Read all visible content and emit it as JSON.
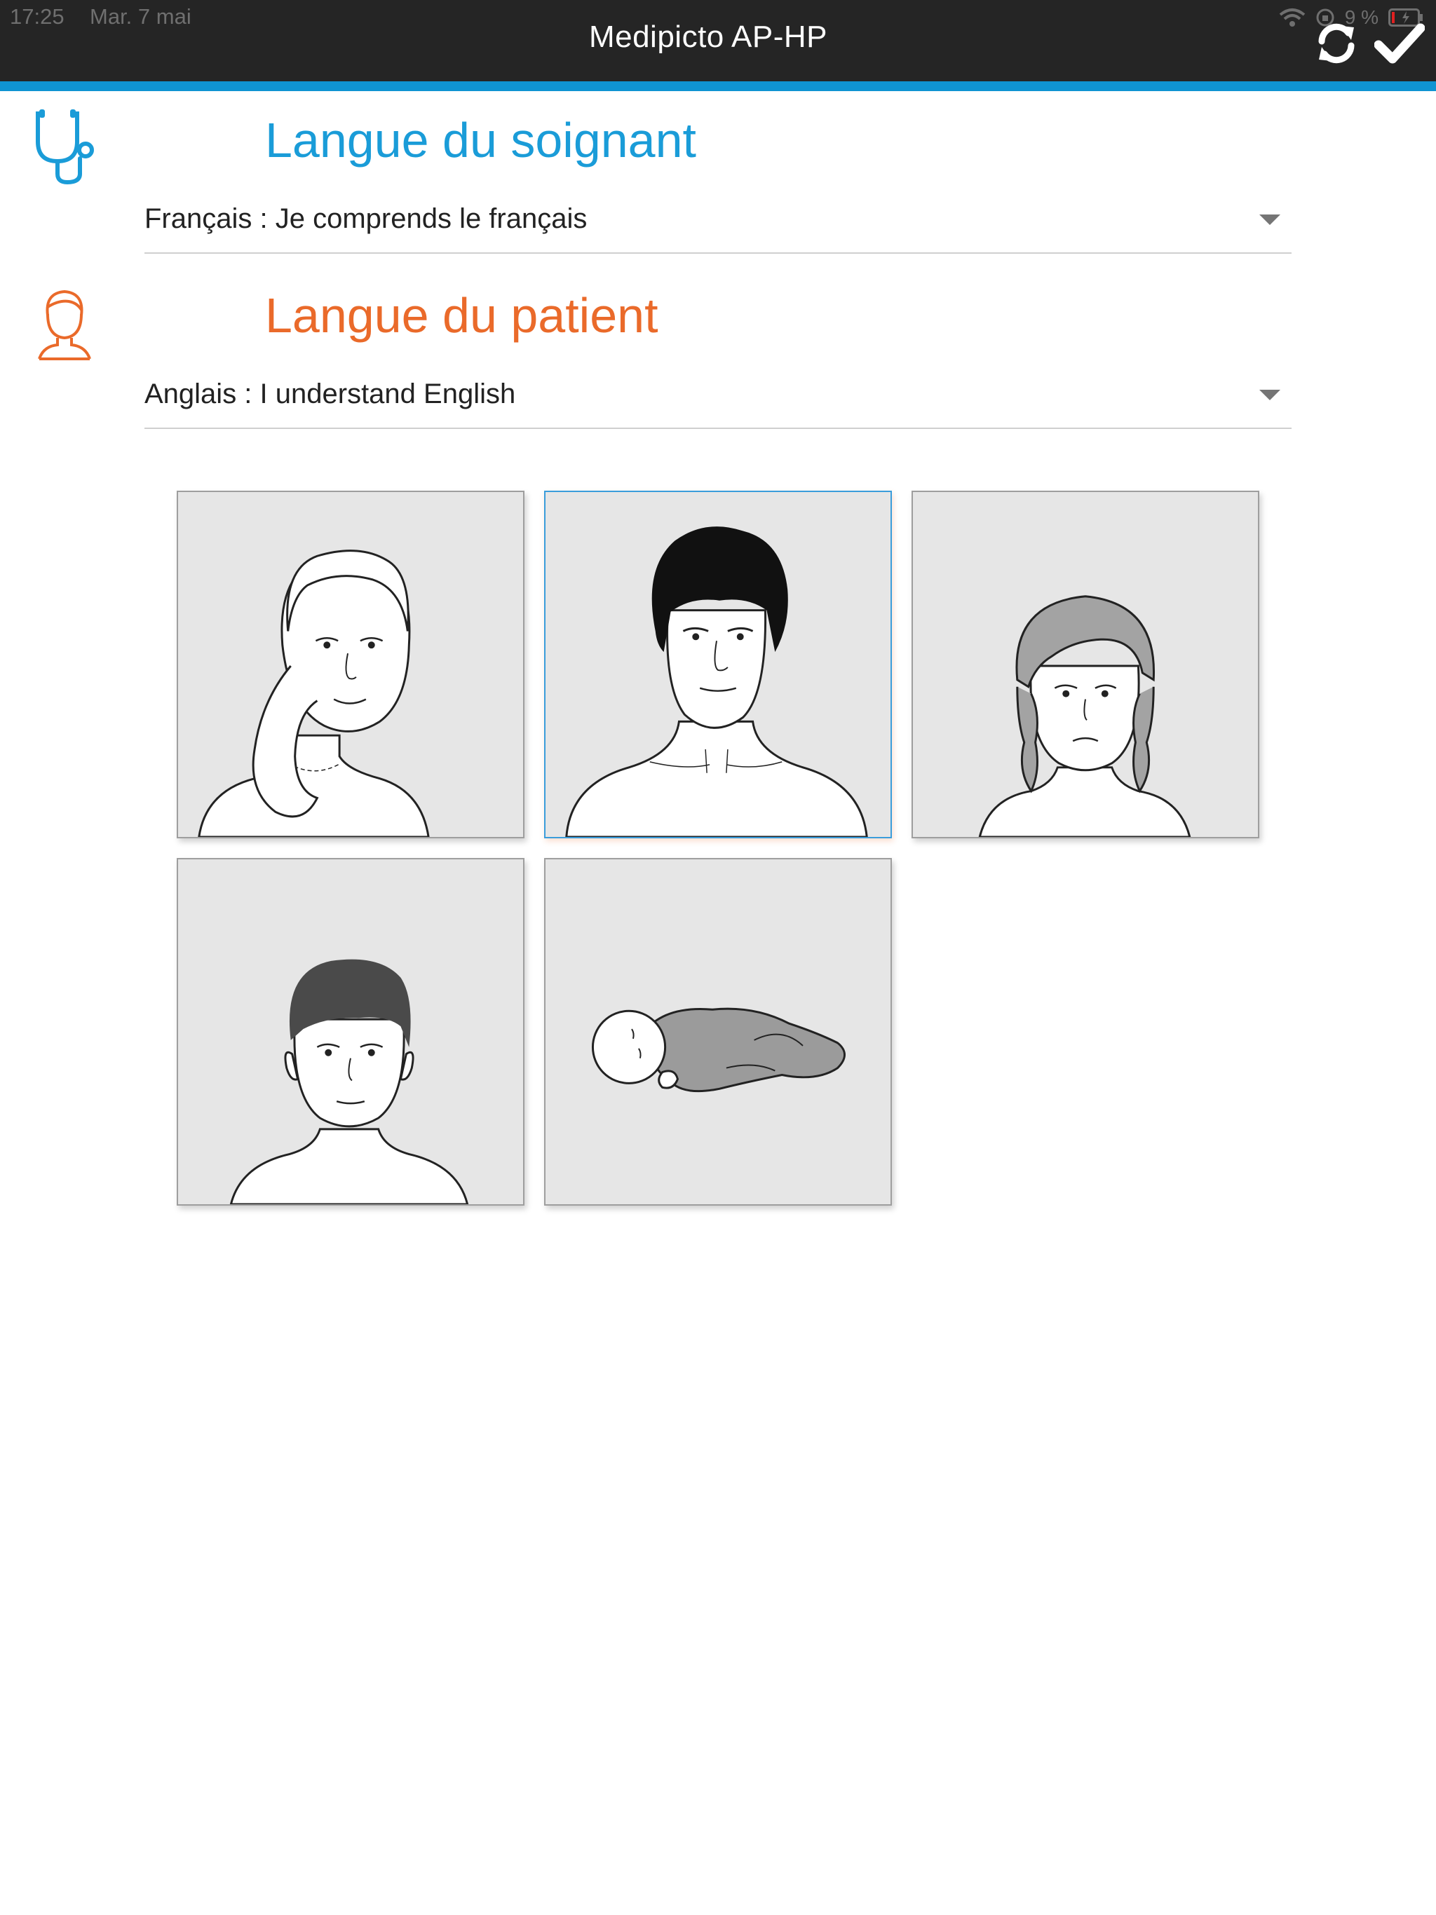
{
  "status_bar": {
    "time": "17:25",
    "date": "Mar. 7 mai",
    "battery": "9 %"
  },
  "header": {
    "title": "Medipicto AP-HP",
    "sync_icon": "sync-icon",
    "confirm_icon": "checkmark-icon"
  },
  "caregiver": {
    "title": "Langue du soignant",
    "selected_language": "Français : Je comprends le français",
    "icon": "stethoscope-icon",
    "color": "#1a9cd8"
  },
  "patient": {
    "title": "Langue du patient",
    "selected_language": "Anglais : I understand English",
    "icon": "person-icon",
    "color": "#ea6a2a"
  },
  "patient_types": [
    {
      "id": "woman",
      "icon": "woman-portrait",
      "selected": false
    },
    {
      "id": "man",
      "icon": "man-portrait",
      "selected": true
    },
    {
      "id": "girl",
      "icon": "girl-portrait",
      "selected": false
    },
    {
      "id": "boy",
      "icon": "boy-portrait",
      "selected": false
    },
    {
      "id": "baby",
      "icon": "baby-portrait",
      "selected": false
    }
  ],
  "colors": {
    "header_bg": "#252525",
    "accent": "#0f94d2",
    "tile_bg": "#e6e6e6"
  }
}
